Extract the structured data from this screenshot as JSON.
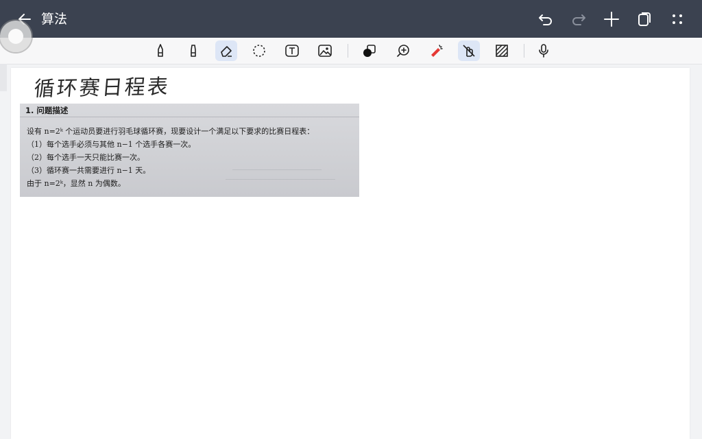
{
  "header": {
    "title": "算法"
  },
  "canvas": {
    "handwritten_title": "循环赛日程表",
    "photo": {
      "section": "1. 问题描述",
      "lines": [
        "设有 n=2ᵏ 个运动员要进行羽毛球循环赛，现要设计一个满足以下要求的比赛日程表：",
        "（1）每个选手必须与其他 n−1 个选手各赛一次。",
        "（2）每个选手一天只能比赛一次。",
        "（3）循环赛一共需要进行 n−1 天。",
        "由于 n=2ᵏ，显然 n 为偶数。"
      ]
    }
  },
  "icons": {
    "back": "arrow-left-icon",
    "undo": "undo-icon",
    "redo": "redo-icon",
    "add": "plus-icon",
    "pages": "copy-pages-icon",
    "more": "dots-grid-icon",
    "tools": [
      "fountain-pen-icon",
      "highlighter-icon",
      "eraser-icon",
      "lasso-icon",
      "text-box-icon",
      "image-icon",
      "shapes-icon",
      "zoom-icon",
      "laser-pointer-icon",
      "finger-draw-icon",
      "pattern-icon",
      "microphone-icon"
    ]
  },
  "colors": {
    "topbar": "#3b4250",
    "active_tool": "#dde6f6",
    "laser": "#e53935"
  }
}
